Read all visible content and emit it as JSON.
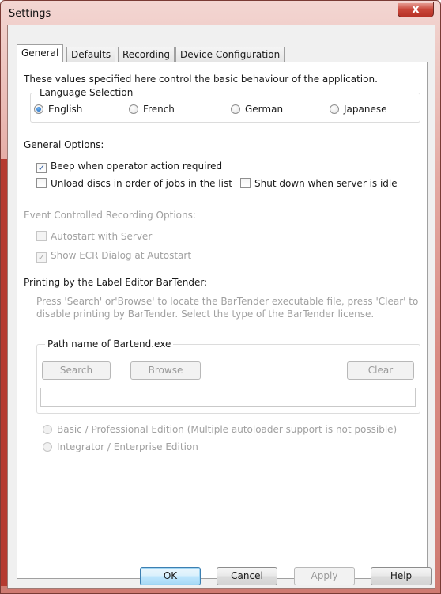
{
  "window": {
    "title": "Settings",
    "close_glyph": "x"
  },
  "tabs": [
    {
      "label": "General",
      "active": true
    },
    {
      "label": "Defaults",
      "active": false
    },
    {
      "label": "Recording",
      "active": false
    },
    {
      "label": "Device Configuration",
      "active": false
    }
  ],
  "general": {
    "intro": "These values specified here control the basic behaviour of the application.",
    "language": {
      "title": "Language Selection",
      "options": [
        {
          "label": "English",
          "checked": true
        },
        {
          "label": "French",
          "checked": false
        },
        {
          "label": "German",
          "checked": false
        },
        {
          "label": "Japanese",
          "checked": false
        }
      ]
    },
    "general_options": {
      "title": "General Options:",
      "beep": {
        "label": "Beep when operator action required",
        "checked": true
      },
      "unload": {
        "label": "Unload discs in order of jobs in the list",
        "checked": false
      },
      "shutdown": {
        "label": "Shut down when server is idle",
        "checked": false
      }
    },
    "ecr": {
      "title": "Event Controlled Recording Options:",
      "autostart": {
        "label": "Autostart with Server",
        "checked": false,
        "enabled": false
      },
      "show_dialog": {
        "label": "Show ECR Dialog at Autostart",
        "checked": true,
        "enabled": false
      }
    },
    "printing": {
      "title": "Printing by the Label Editor BarTender:",
      "description_line1": "Press 'Search' or'Browse' to locate the BarTender executable file, press 'Clear' to",
      "description_line2": "disable printing by BarTender. Select the type of the BarTender license.",
      "path_group_title": "Path name of Bartend.exe",
      "search_label": "Search",
      "browse_label": "Browse",
      "clear_label": "Clear",
      "path_value": "",
      "edition_basic": "Basic / Professional Edition (Multiple autoloader support is not possible)",
      "edition_integrator": "Integrator / Enterprise Edition"
    }
  },
  "footer": {
    "ok": "OK",
    "cancel": "Cancel",
    "apply": "Apply",
    "help": "Help"
  }
}
